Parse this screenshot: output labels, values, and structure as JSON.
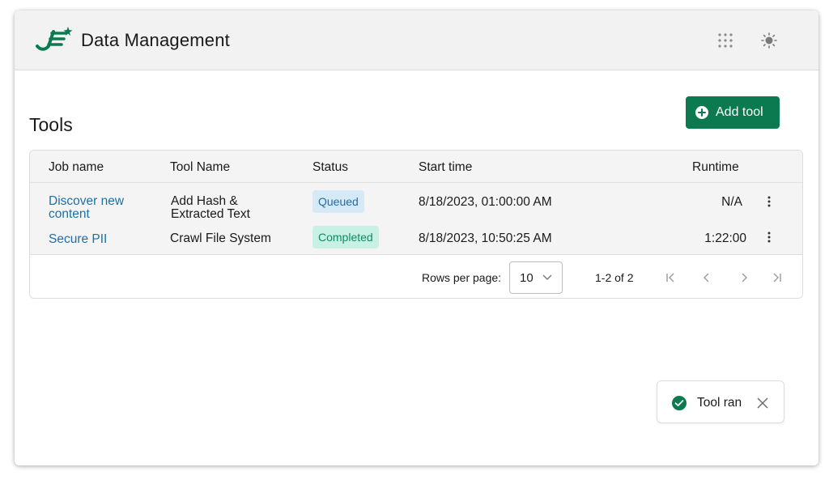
{
  "app": {
    "title": "Data Management",
    "brand_color": "#0b7a50"
  },
  "header": {
    "apps_icon": "grid-dots-icon",
    "theme_icon": "sun-icon"
  },
  "page": {
    "title": "Tools",
    "add_button_label": "Add tool"
  },
  "table": {
    "columns": [
      "Job name",
      "Tool Name",
      "Status",
      "Start time",
      "Runtime"
    ],
    "rows": [
      {
        "job_name_line1": "Discover new",
        "job_name_line2": "content",
        "tool_name_line1": "Add Hash &",
        "tool_name_line2": "Extracted Text",
        "status": "Queued",
        "status_color": "#1f6fa3",
        "start_time": "8/18/2023, 01:00:00 AM",
        "runtime": "N/A"
      },
      {
        "job_name": "Secure PII",
        "tool_name": "Crawl File System",
        "status": "Completed",
        "status_color": "#0f8a5f",
        "start_time": "8/18/2023, 10:50:25 AM",
        "runtime": "1:22:00"
      }
    ]
  },
  "pagination": {
    "rows_per_page_label": "Rows per page:",
    "rows_per_page_value": "10",
    "range_text": "1-2 of 2"
  },
  "toast": {
    "message": "Tool ran",
    "icon": "check-circle-icon",
    "color": "#0b7a50"
  }
}
